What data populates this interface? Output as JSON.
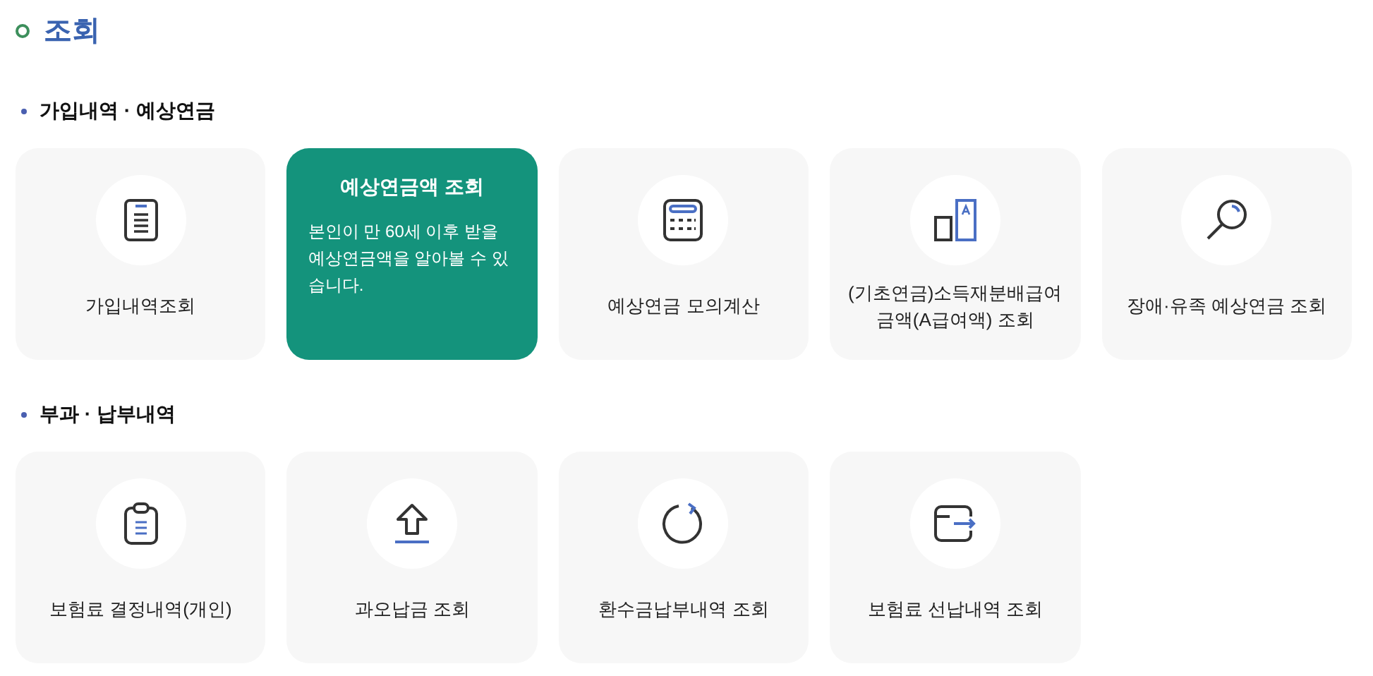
{
  "page_title": "조회",
  "sections": [
    {
      "title": "가입내역 · 예상연금",
      "items": [
        {
          "label": "가입내역조회",
          "selected": false
        },
        {
          "label": "예상연금액 조회",
          "selected": true,
          "description": "본인이 만 60세 이후 받을 예상연금액을 알아볼 수 있습니다."
        },
        {
          "label": "예상연금 모의계산",
          "selected": false
        },
        {
          "label": "(기초연금)소득재분배급여 금액(A급여액) 조회",
          "selected": false
        },
        {
          "label": "장애·유족 예상연금 조회",
          "selected": false
        }
      ]
    },
    {
      "title": "부과 · 납부내역",
      "items": [
        {
          "label": "보험료 결정내역(개인)",
          "selected": false
        },
        {
          "label": "과오납금 조회",
          "selected": false
        },
        {
          "label": "환수금납부내역 조회",
          "selected": false
        },
        {
          "label": "보험료 선납내역 조회",
          "selected": false
        }
      ]
    }
  ]
}
